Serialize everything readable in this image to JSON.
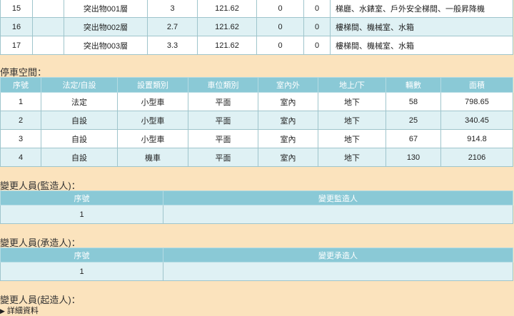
{
  "floors": {
    "rows": [
      {
        "no": "15",
        "blank": "",
        "name": "突出物001層",
        "height": "3",
        "area": "121.62",
        "v1": "0",
        "v2": "0",
        "use": "梯廳、水錶室、戶外安全梯間、一般昇降機"
      },
      {
        "no": "16",
        "blank": "",
        "name": "突出物002層",
        "height": "2.7",
        "area": "121.62",
        "v1": "0",
        "v2": "0",
        "use": "樓梯間、機械室、水箱"
      },
      {
        "no": "17",
        "blank": "",
        "name": "突出物003層",
        "height": "3.3",
        "area": "121.62",
        "v1": "0",
        "v2": "0",
        "use": "樓梯間、機械室、水箱"
      }
    ]
  },
  "parking": {
    "title": "停車空間：",
    "headers": [
      "序號",
      "法定/自設",
      "設置類別",
      "車位類別",
      "室內外",
      "地上/下",
      "輛數",
      "面積"
    ],
    "rows": [
      [
        "1",
        "法定",
        "小型車",
        "平面",
        "室內",
        "地下",
        "58",
        "798.65"
      ],
      [
        "2",
        "自設",
        "小型車",
        "平面",
        "室內",
        "地下",
        "25",
        "340.45"
      ],
      [
        "3",
        "自設",
        "小型車",
        "平面",
        "室內",
        "地下",
        "67",
        "914.8"
      ],
      [
        "4",
        "自設",
        "機車",
        "平面",
        "室內",
        "地下",
        "130",
        "2106"
      ]
    ]
  },
  "supervisor": {
    "title": "變更人員(監造人)：",
    "headers": [
      "序號",
      "變更監造人"
    ],
    "row": [
      "1",
      ""
    ]
  },
  "contractor": {
    "title": "變更人員(承造人)：",
    "headers": [
      "序號",
      "變更承造人"
    ],
    "row": [
      "1",
      ""
    ]
  },
  "builder": {
    "title": "變更人員(起造人)："
  },
  "details": {
    "label": "詳細資料"
  }
}
